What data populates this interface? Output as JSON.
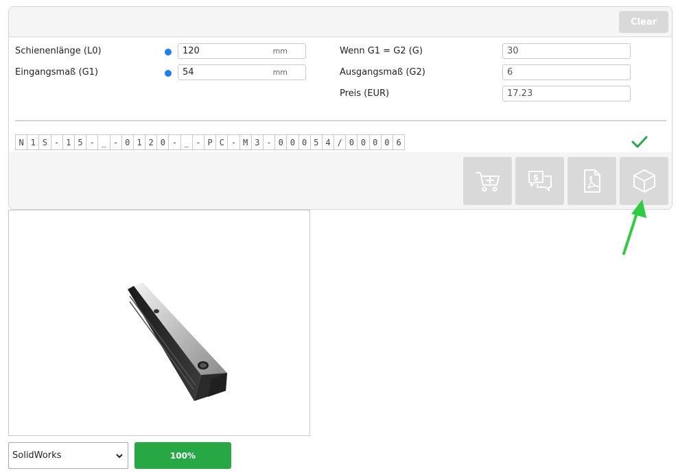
{
  "header": {
    "clear_label": "Clear"
  },
  "form": {
    "left": [
      {
        "label": "Schienenlänge (L0)",
        "value": "120",
        "unit": "mm"
      },
      {
        "label": "Eingangsmaß (G1)",
        "value": "54",
        "unit": "mm"
      }
    ],
    "right": [
      {
        "label": "Wenn G1 = G2 (G)",
        "value": "30"
      },
      {
        "label": "Ausgangsmaß (G2)",
        "value": "6"
      },
      {
        "label": "Preis (EUR)",
        "value": "17.23"
      }
    ]
  },
  "part_code": [
    "N",
    "1",
    "S",
    "-",
    "1",
    "5",
    "-",
    "_",
    "-",
    "0",
    "1",
    "2",
    "0",
    "-",
    "_",
    "-",
    "P",
    "C",
    "-",
    "M",
    "3",
    "-",
    "0",
    "0",
    "0",
    "5",
    "4",
    "/",
    "0",
    "0",
    "0",
    "0",
    "6"
  ],
  "status": {
    "valid_icon": "checkmark-icon",
    "color": "#28a745"
  },
  "actions": [
    {
      "name": "add-to-cart-button",
      "icon": "cart-plus-icon"
    },
    {
      "name": "request-quote-button",
      "icon": "price-chat-icon"
    },
    {
      "name": "pdf-button",
      "icon": "pdf-icon"
    },
    {
      "name": "cad-model-button",
      "icon": "cube-icon"
    }
  ],
  "viewer": {
    "model": "linear-rail-3d-model"
  },
  "download": {
    "format_selected": "SolidWorks",
    "progress_label": "100%",
    "progress": 1.0
  },
  "annotation": {
    "arrow_color": "#2ecc40"
  }
}
